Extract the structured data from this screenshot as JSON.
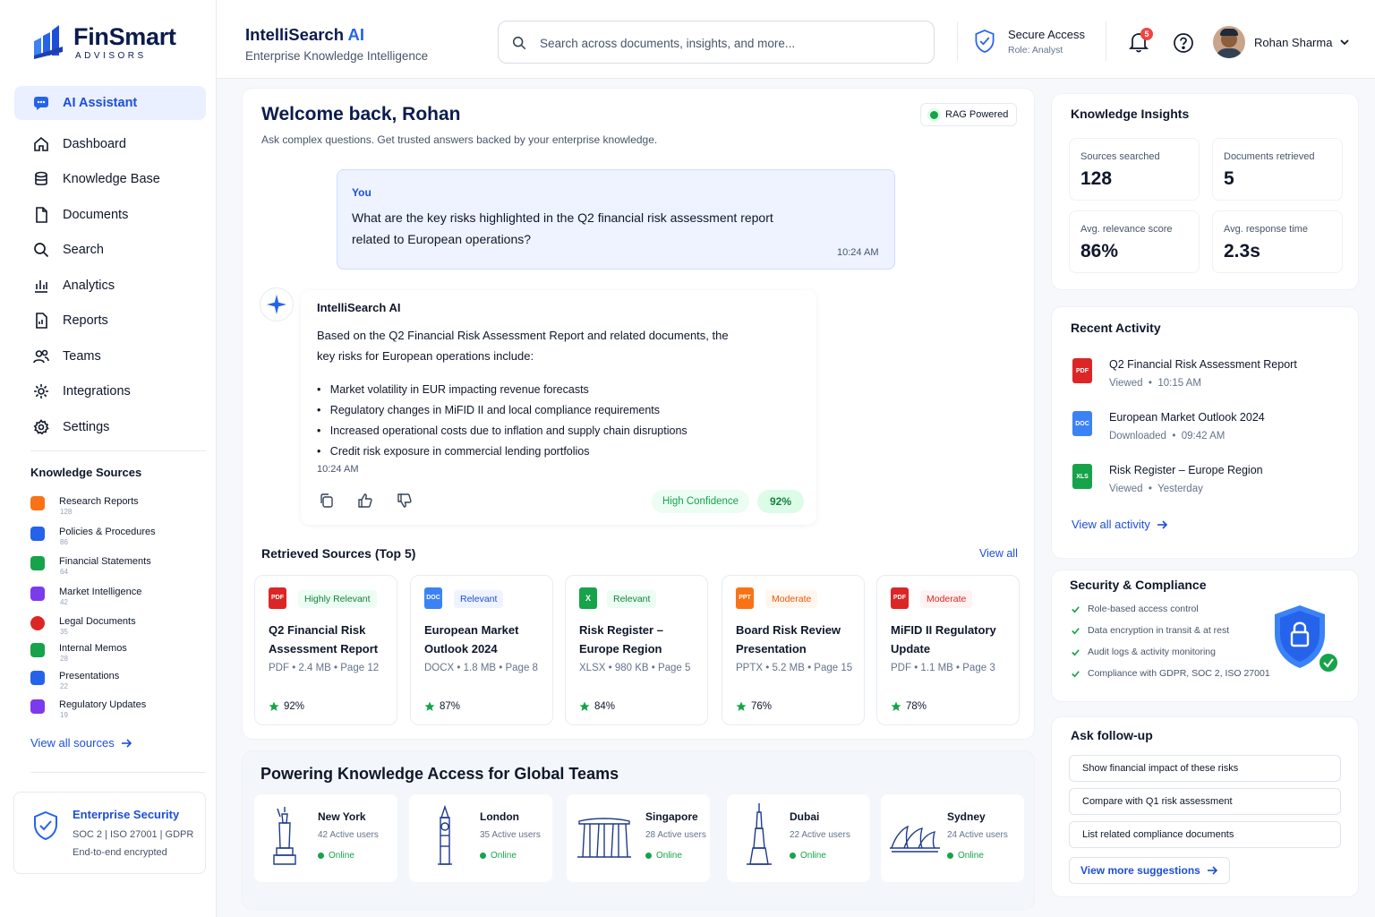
{
  "brand": {
    "name": "FinSmart",
    "sub": "ADVISORS"
  },
  "header": {
    "app_title": "IntelliSearch",
    "app_title_ai": " AI",
    "app_subtitle": "Enterprise Knowledge Intelligence",
    "search_placeholder": "Search across documents, insights, and more...",
    "secure_title": "Secure Access",
    "secure_role": "Role: Analyst",
    "notification_count": "5",
    "user_name": "Rohan Sharma"
  },
  "nav": [
    {
      "label": "AI Assistant",
      "icon": "chat-icon"
    },
    {
      "label": "Dashboard",
      "icon": "home-icon"
    },
    {
      "label": "Knowledge Base",
      "icon": "database-icon"
    },
    {
      "label": "Documents",
      "icon": "document-icon"
    },
    {
      "label": "Search",
      "icon": "search-icon"
    },
    {
      "label": "Analytics",
      "icon": "bar-chart-icon"
    },
    {
      "label": "Reports",
      "icon": "report-icon"
    },
    {
      "label": "Teams",
      "icon": "users-icon"
    },
    {
      "label": "Integrations",
      "icon": "integrations-icon"
    },
    {
      "label": "Settings",
      "icon": "gear-icon"
    }
  ],
  "knowledge_sources": {
    "title": "Knowledge Sources",
    "items": [
      {
        "name": "Research Reports",
        "count": "128",
        "color": "#f97316"
      },
      {
        "name": "Policies & Procedures",
        "count": "86",
        "color": "#2563eb"
      },
      {
        "name": "Financial Statements",
        "count": "64",
        "color": "#16a34a"
      },
      {
        "name": "Market Intelligence",
        "count": "42",
        "color": "#7c3aed"
      },
      {
        "name": "Legal Documents",
        "count": "35",
        "color": "#dc2626"
      },
      {
        "name": "Internal Memos",
        "count": "28",
        "color": "#16a34a"
      },
      {
        "name": "Presentations",
        "count": "22",
        "color": "#2563eb"
      },
      {
        "name": "Regulatory Updates",
        "count": "19",
        "color": "#7c3aed"
      }
    ],
    "view_all": "View all sources"
  },
  "enterprise_security": {
    "title": "Enterprise Security",
    "line1": "SOC 2 | ISO 27001 | GDPR",
    "line2": "End-to-end encrypted"
  },
  "welcome": {
    "title": "Welcome back, Rohan",
    "subtitle": "Ask complex questions. Get trusted answers backed by your enterprise knowledge.",
    "rag_label": "RAG Powered"
  },
  "user_message": {
    "sender": "You",
    "line1": "What are the key risks highlighted in the Q2 financial risk assessment report",
    "line2": "related to European operations?",
    "time": "10:24 AM"
  },
  "ai_message": {
    "sender": "IntelliSearch AI",
    "intro1": "Based on the Q2 Financial Risk Assessment Report and related documents, the",
    "intro2": "key risks for European operations include:",
    "bullets": [
      "Market volatility in EUR impacting revenue forecasts",
      "Regulatory changes in MiFID II and local compliance requirements",
      "Increased operational costs due to inflation and supply chain disruptions",
      "Credit risk exposure in commercial lending portfolios"
    ],
    "time": "10:24 AM",
    "confidence_label": "High Confidence",
    "confidence_value": "92%"
  },
  "sources": {
    "title": "Retrieved Sources (Top 5)",
    "view_all": "View all",
    "items": [
      {
        "badge": "Highly Relevant",
        "badge_kind": "green",
        "type_label": "PDF",
        "icon_color": "#dc2626",
        "title": "Q2 Financial Risk Assessment Report",
        "meta": "PDF • 2.4 MB • Page 12",
        "score": "92%"
      },
      {
        "badge": "Relevant",
        "badge_kind": "blue",
        "type_label": "DOC",
        "icon_color": "#2563eb",
        "title": "European Market Outlook 2024",
        "meta": "DOCX • 1.8 MB • Page 8",
        "score": "87%"
      },
      {
        "badge": "Relevant",
        "badge_kind": "green",
        "type_label": "X",
        "icon_color": "#16a34a",
        "title": "Risk Register – Europe Region",
        "meta": "XLSX • 980 KB • Page 5",
        "score": "84%"
      },
      {
        "badge": "Moderate",
        "badge_kind": "orange",
        "type_label": "PPT",
        "icon_color": "#f97316",
        "title": "Board Risk Review Presentation",
        "meta": "PPTX • 5.2 MB • Page 15",
        "score": "76%"
      },
      {
        "badge": "Moderate",
        "badge_kind": "red",
        "type_label": "PDF",
        "icon_color": "#dc2626",
        "title": "MiFID II Regulatory Update",
        "meta": "PDF • 1.1 MB • Page 3",
        "score": "78%"
      }
    ]
  },
  "teams": {
    "title": "Powering Knowledge Access for Global Teams",
    "cities": [
      {
        "name": "New York",
        "users": "42 Active users",
        "status": "Online"
      },
      {
        "name": "London",
        "users": "35 Active users",
        "status": "Online"
      },
      {
        "name": "Singapore",
        "users": "28 Active users",
        "status": "Online"
      },
      {
        "name": "Dubai",
        "users": "22 Active users",
        "status": "Online"
      },
      {
        "name": "Sydney",
        "users": "24 Active users",
        "status": "Online"
      }
    ]
  },
  "insights": {
    "title": "Knowledge Insights",
    "stats": [
      {
        "label": "Sources searched",
        "value": "128"
      },
      {
        "label": "Documents retrieved",
        "value": "5"
      },
      {
        "label": "Avg. relevance score",
        "value": "86%"
      },
      {
        "label": "Avg. response time",
        "value": "2.3s"
      }
    ]
  },
  "activity": {
    "title": "Recent Activity",
    "items": [
      {
        "type_label": "PDF",
        "color": "#dc2626",
        "title": "Q2 Financial Risk Assessment Report",
        "action": "Viewed",
        "time": "10:15 AM"
      },
      {
        "type_label": "DOC",
        "color": "#2563eb",
        "title": "European Market Outlook 2024",
        "action": "Downloaded",
        "time": "09:42 AM"
      },
      {
        "type_label": "XLS",
        "color": "#16a34a",
        "title": "Risk Register – Europe Region",
        "action": "Viewed",
        "time": "Yesterday"
      }
    ],
    "view_all": "View all activity"
  },
  "compliance": {
    "title": "Security & Compliance",
    "items": [
      "Role-based access control",
      "Data encryption in transit & at rest",
      "Audit logs & activity monitoring",
      "Compliance with GDPR, SOC 2, ISO 27001"
    ]
  },
  "followup": {
    "title": "Ask follow-up",
    "suggestions": [
      "Show financial impact of these risks",
      "Compare with Q1 risk assessment",
      "List related compliance documents"
    ],
    "more": "View more suggestions"
  }
}
